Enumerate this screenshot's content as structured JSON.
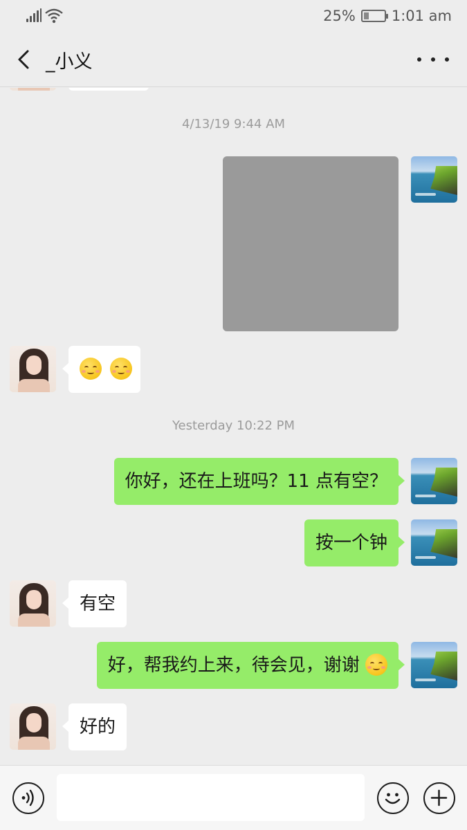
{
  "status_bar": {
    "battery": "25%",
    "battery_level": 0.25,
    "time": "1:01 am"
  },
  "header": {
    "title": "_小义"
  },
  "chat": {
    "timestamps": [
      "4/13/19 9:44 AM",
      "Yesterday 10:22 PM"
    ],
    "messages": [
      {
        "from": "me",
        "kind": "image"
      },
      {
        "from": "them",
        "kind": "emoji",
        "emoji": [
          "smiling-face-emoji",
          "smiling-face-emoji"
        ]
      },
      {
        "from": "me",
        "kind": "text",
        "text": "你好，还在上班吗？11 点有空？"
      },
      {
        "from": "me",
        "kind": "text",
        "text": "按一个钟"
      },
      {
        "from": "them",
        "kind": "text",
        "text": "有空"
      },
      {
        "from": "me",
        "kind": "text",
        "text": "好，帮我约上来，待会见，谢谢",
        "trailing_emoji": "smiling-face-emoji"
      },
      {
        "from": "them",
        "kind": "text",
        "text": "好的"
      }
    ]
  },
  "input_bar": {
    "value": "",
    "icons": [
      "voice-icon",
      "emoji-icon",
      "plus-icon"
    ]
  },
  "colors": {
    "background": "#ededed",
    "outgoing_bubble": "#95ec69",
    "incoming_bubble": "#ffffff",
    "timestamp_text": "#9b9b9b"
  }
}
